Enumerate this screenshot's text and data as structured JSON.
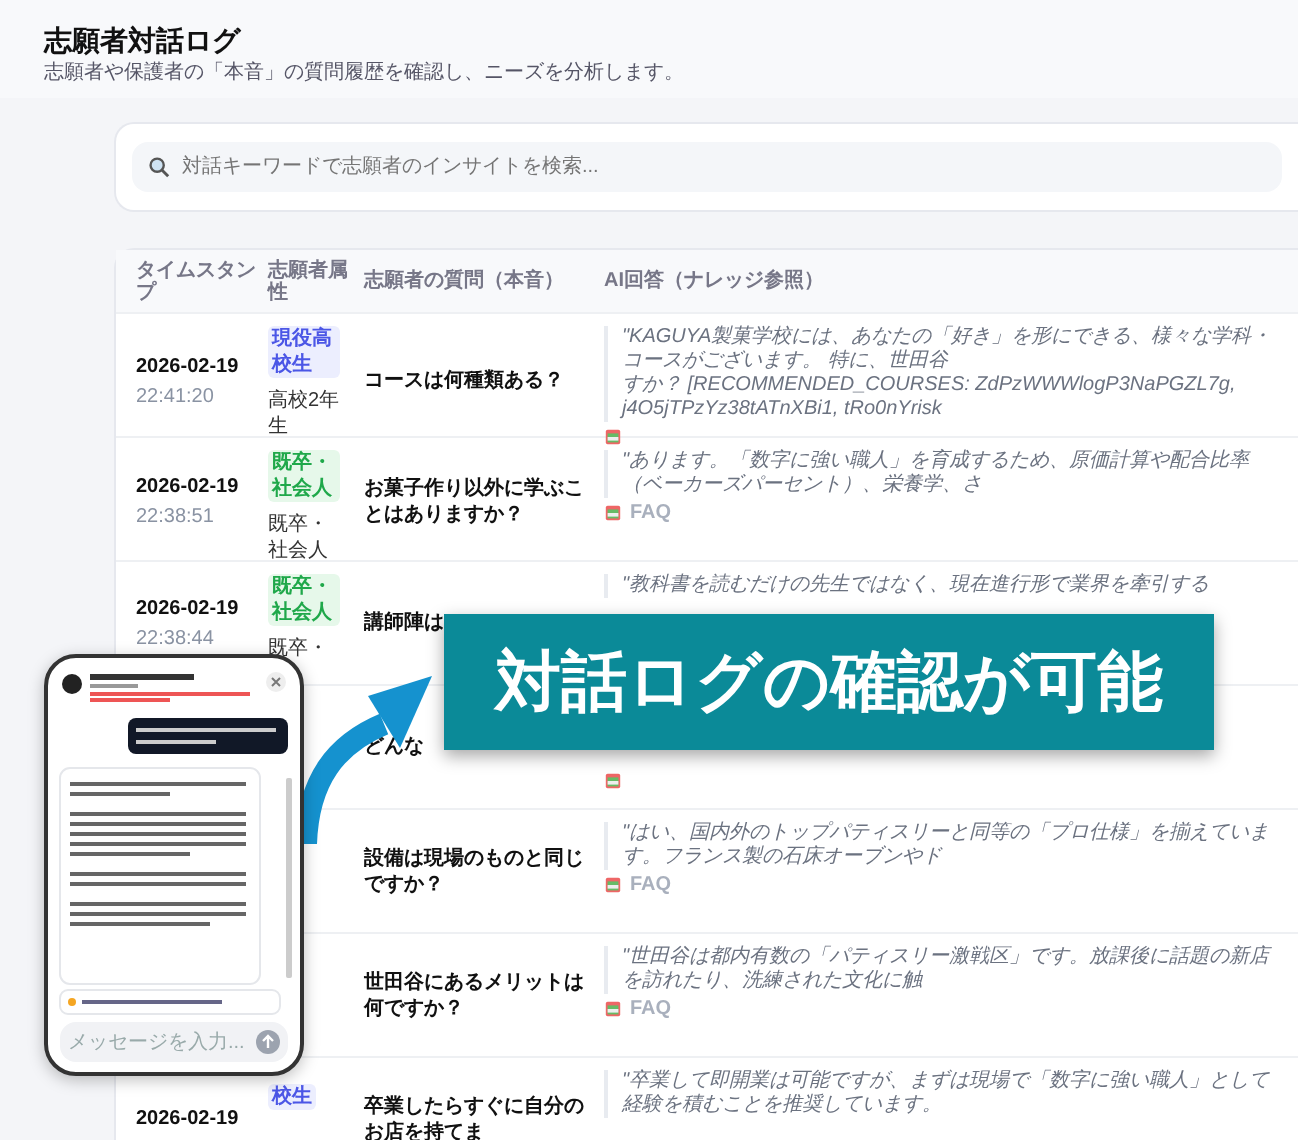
{
  "page": {
    "title": "志願者対話ログ",
    "subtitle": "志願者や保護者の「本音」の質問履歴を確認し、ニーズを分析します。"
  },
  "search": {
    "placeholder": "対話キーワードで志願者のインサイトを検索..."
  },
  "table": {
    "columns": [
      "タイムスタンプ",
      "志願者属性",
      "志願者の質問（本音）",
      "AI回答（ナレッジ参照）"
    ],
    "rows": [
      {
        "date": "2026-02-19",
        "time": "22:41:20",
        "tag": {
          "label": "現役高校生",
          "kind": "student"
        },
        "attribute": "高校2年生",
        "question": "コースは何種類ある？",
        "answer_lines": [
          "\"KAGUYA製菓学校には、あなたの「好き」を形にできる、様々な学科・コースがございます。 特に、世田谷",
          "すか？ [RECOMMENDED_COURSES: ZdPzWWWlogP3NaPGZL7g, j4O5jTPzYz38tATnXBi1, tRo0nYrisk"
        ],
        "has_source": true
      },
      {
        "date": "2026-02-19",
        "time": "22:38:51",
        "tag": {
          "label": "既卒・社会人",
          "kind": "graduate"
        },
        "attribute": "既卒・社会人",
        "question": "お菓子作り以外に学ぶことはありますか？",
        "answer_lines": [
          "\"あります。「数字に強い職人」を育成するため、原価計算や配合比率（ベーカーズパーセント）、栄養学、さ"
        ],
        "has_source": true,
        "source_label": "FAQ"
      },
      {
        "date": "2026-02-19",
        "time": "22:38:44",
        "tag": {
          "label": "既卒・社会人",
          "kind": "graduate"
        },
        "attribute": "既卒・",
        "question": "講師陣は",
        "answer_lines": [
          "\"教科書を読むだけの先生ではなく、現在進行形で業界を牽引する"
        ]
      },
      {
        "question": "どんな",
        "has_source": true
      },
      {
        "question": "設備は現場のものと同じですか？",
        "answer_lines": [
          "\"はい、国内外のトップパティスリーと同等の「プロ仕様」を揃えています。フランス製の石床オーブンやド"
        ],
        "has_source": true,
        "source_label": "FAQ"
      },
      {
        "question": "世田谷にあるメリットは何ですか？",
        "answer_lines": [
          "\"世田谷は都内有数の「パティスリー激戦区」です。放課後に話題の新店を訪れたり、洗練された文化に触"
        ],
        "has_source": true,
        "source_label": "FAQ"
      },
      {
        "date": "2026-02-19",
        "tag": {
          "label": "校生",
          "kind": "student"
        },
        "question": "卒業したらすぐに自分のお店を持てま",
        "answer_lines": [
          "\"卒業して即開業は可能ですが、まずは現場で「数字に強い職人」として経験を積むことを推奨しています。"
        ]
      }
    ]
  },
  "banner": {
    "text": "対話ログの確認が可能"
  },
  "phone": {
    "placeholder": "メッセージを入力..."
  }
}
